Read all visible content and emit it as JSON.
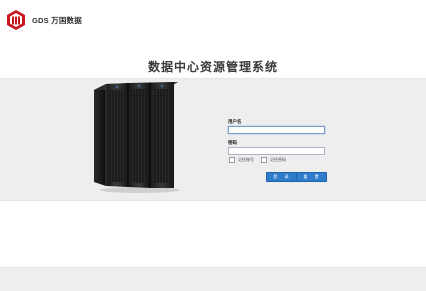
{
  "brand": {
    "logo_icon": "gds-logo-icon",
    "company_name": "GDS 万国数据",
    "color": "#c8161d"
  },
  "system_title": "数据中心资源管理系统",
  "hero_image": "server-rack-image",
  "login_form": {
    "username_label": "用户名",
    "username_value": "",
    "password_label": "密码",
    "password_value": "",
    "remember_account_label": "记住账号",
    "remember_account_checked": false,
    "remember_password_label": "记住密码",
    "remember_password_checked": false,
    "login_button": "登 录",
    "reset_button": "重 置",
    "button_color": "#2f7ccc"
  }
}
